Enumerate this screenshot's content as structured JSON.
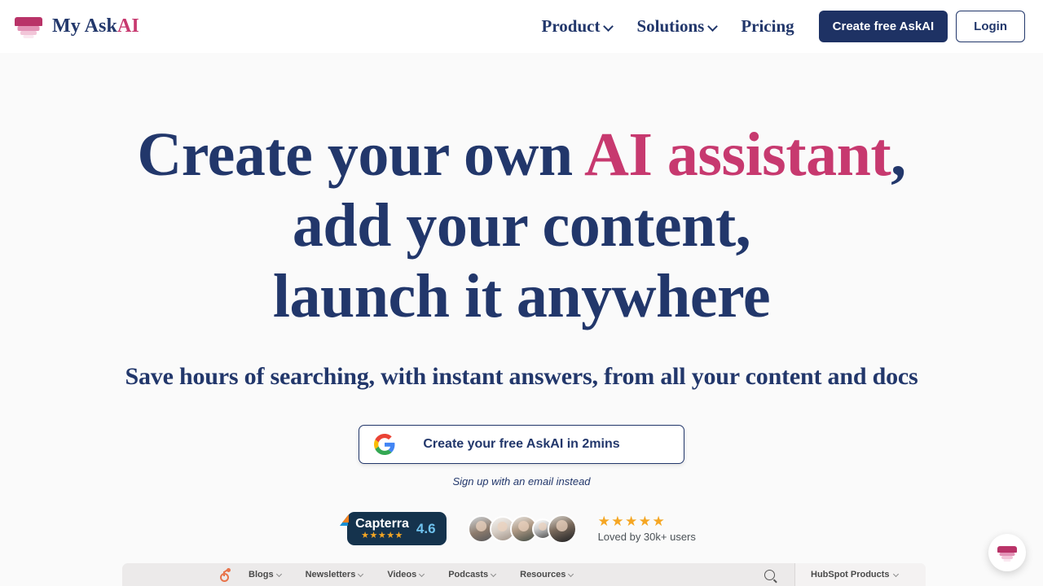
{
  "header": {
    "logo_icon": "funnel-logo-icon",
    "brand_name_prefix": "My Ask",
    "brand_name_accent": "AI",
    "nav": [
      {
        "label": "Product",
        "has_dropdown": true
      },
      {
        "label": "Solutions",
        "has_dropdown": true
      },
      {
        "label": "Pricing",
        "has_dropdown": false
      }
    ],
    "cta_primary": "Create free AskAI",
    "cta_secondary": "Login"
  },
  "hero": {
    "headline_line1_a": "Create your own ",
    "headline_line1_accent": "AI assistant",
    "headline_line1_b": ",",
    "headline_line2": "add your content,",
    "headline_line3": "launch it anywhere",
    "subheadline": "Save hours of searching, with instant answers, from all your content and docs"
  },
  "cta": {
    "google_icon": "google-g-icon",
    "google_button_label": "Create your free AskAI in 2mins",
    "email_link_label": "Sign up with an email instead"
  },
  "social_proof": {
    "capterra": {
      "name": "Capterra",
      "stars": "★★★★★",
      "score": "4.6"
    },
    "avatars_count": 5,
    "rating_stars": "★★★★★",
    "rating_text": "Loved by 30k+ users"
  },
  "mockup": {
    "logo_icon": "hubspot-sprocket-icon",
    "items": [
      {
        "label": "Blogs",
        "has_dropdown": true
      },
      {
        "label": "Newsletters",
        "has_dropdown": true
      },
      {
        "label": "Videos",
        "has_dropdown": true
      },
      {
        "label": "Podcasts",
        "has_dropdown": true
      },
      {
        "label": "Resources",
        "has_dropdown": true
      }
    ],
    "search_icon": "search-icon",
    "products_label": "HubSpot Products"
  },
  "chat_widget": {
    "icon": "funnel-logo-icon"
  },
  "colors": {
    "navy": "#22376b",
    "navy_button": "#1e3264",
    "pink": "#c7396f",
    "logo_pink": "#b93368",
    "gold": "#f5a623",
    "capterra_bg": "#15334d",
    "capterra_score": "#6fc3ef",
    "page_bg": "#fafafa",
    "hubspot_orange": "#e8734a"
  }
}
